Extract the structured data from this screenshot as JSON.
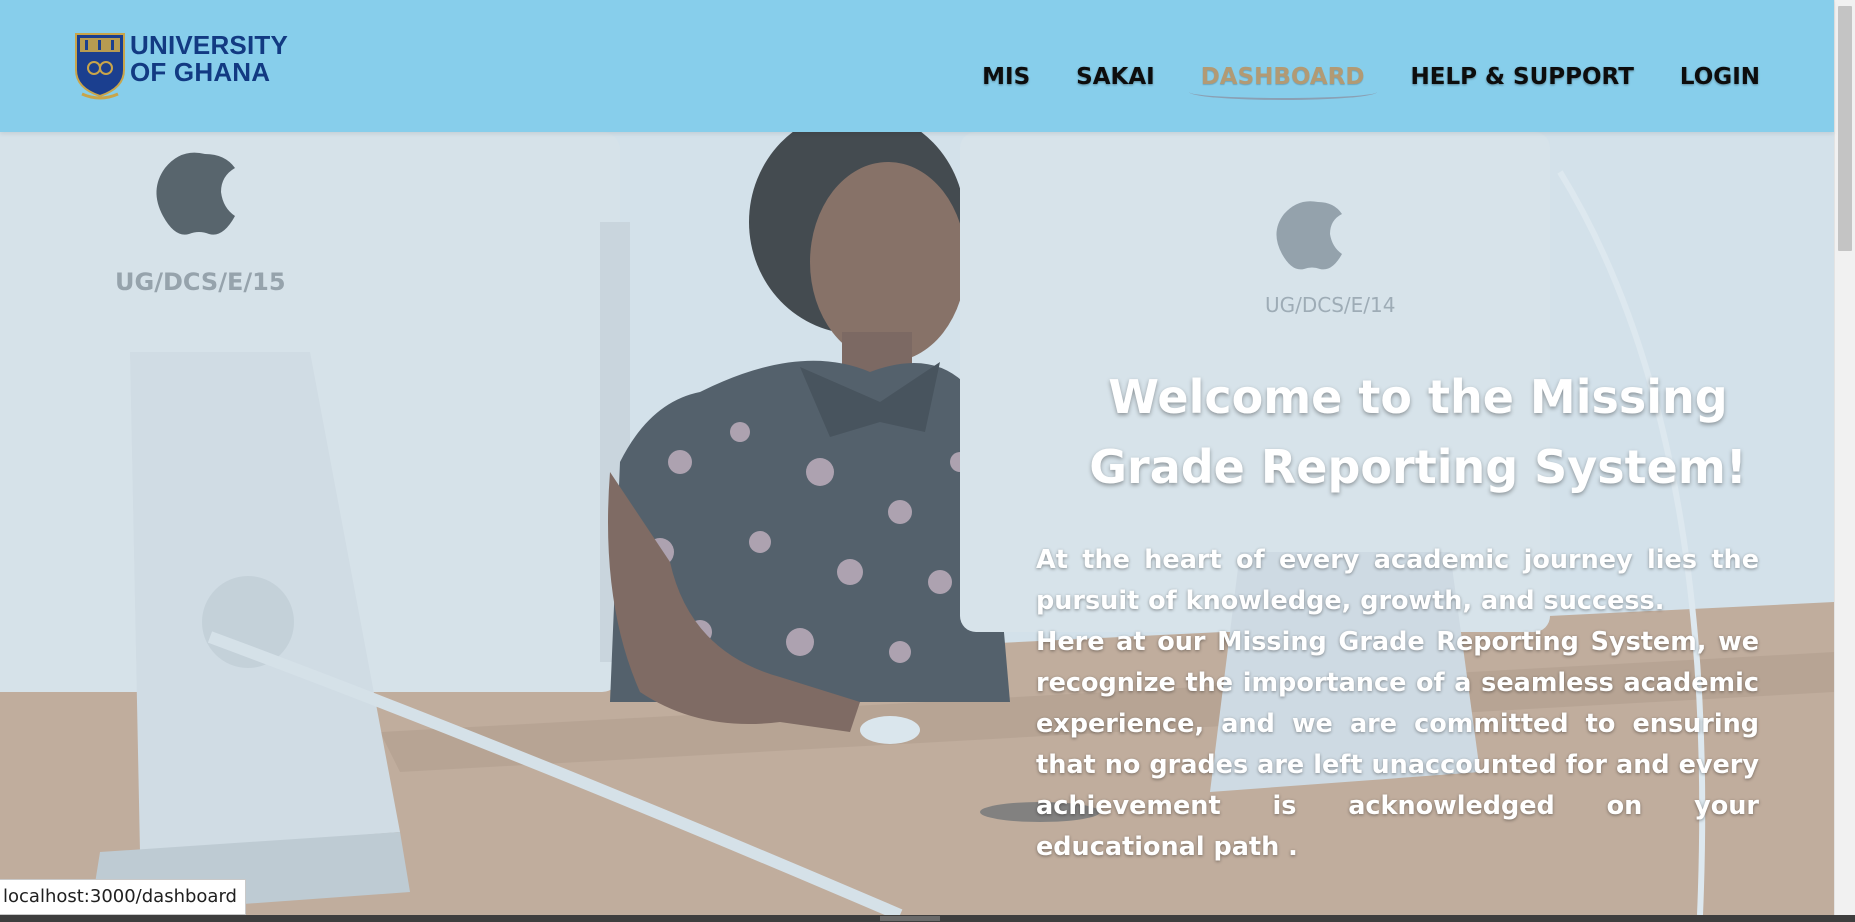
{
  "brand": {
    "line1": "UNIVERSITY",
    "line2": "OF GHANA",
    "primary_color": "#123a82",
    "header_color": "#87ceeb"
  },
  "nav": {
    "items": [
      {
        "label": "MIS",
        "active": false
      },
      {
        "label": "SAKAI",
        "active": false
      },
      {
        "label": "DASHBOARD",
        "active": true
      },
      {
        "label": "HELP & SUPPORT",
        "active": false
      },
      {
        "label": "LOGIN",
        "active": false
      }
    ],
    "active_color": "#b29a74"
  },
  "hero": {
    "title": "Welcome to the Missing Grade Reporting System!",
    "paragraph1": "At the heart of every academic journey lies the pursuit of knowledge, growth, and success.",
    "paragraph2": "Here at our Missing Grade Reporting System, we recognize the importance of a seamless academic experience, and we are committed to ensuring that no grades are left unaccounted for and every achievement is acknowledged on your educational path .",
    "monitor_label_left": "UG/DCS/E/15",
    "monitor_label_right": "UG/DCS/E/14"
  },
  "status_bar": {
    "url": "localhost:3000/dashboard"
  }
}
